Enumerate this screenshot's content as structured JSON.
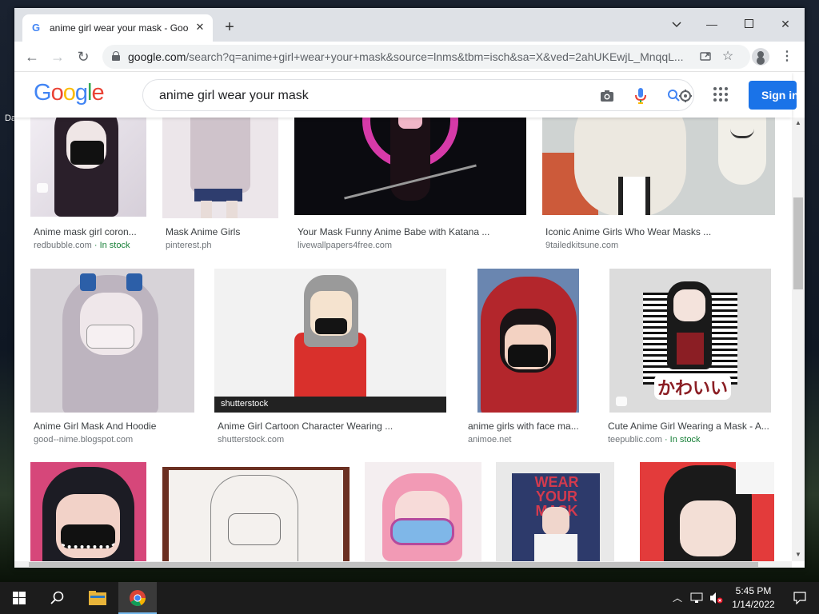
{
  "desktop": {
    "partial_labels": [
      "Da"
    ]
  },
  "browser": {
    "tab_title": "anime girl wear your mask - Goo",
    "url_host": "google.com",
    "url_rest": "/search?q=anime+girl+wear+your+mask&source=lnms&tbm=isch&sa=X&ved=2ahUKEwjL_MnqqL..."
  },
  "google": {
    "logo_letters": [
      "G",
      "o",
      "o",
      "g",
      "l",
      "e"
    ],
    "logo_colors": [
      "#4285f4",
      "#ea4335",
      "#fbbc05",
      "#4285f4",
      "#34a853",
      "#ea4335"
    ],
    "query": "anime girl wear your mask",
    "signin_label": "Sign in"
  },
  "results": [
    {
      "caption": "Anime mask girl coron...",
      "source": "redbubble.com",
      "stock": "· In stock",
      "palette": [
        "#e8e4ee",
        "#2a1f2a"
      ]
    },
    {
      "caption": "Mask Anime Girls",
      "source": "pinterest.ph",
      "stock": "",
      "palette": [
        "#e9e3e8",
        "#b9aab5"
      ]
    },
    {
      "caption": "Your Mask Funny Anime Babe with Katana ...",
      "source": "livewallpapers4free.com",
      "stock": "",
      "palette": [
        "#0b0b10",
        "#d63aa8"
      ]
    },
    {
      "caption": "Iconic Anime Girls Who Wear Masks ...",
      "source": "9tailedkitsune.com",
      "stock": "",
      "palette": [
        "#d9d6cf",
        "#cc5a3a"
      ]
    },
    {
      "caption": "Anime Girl Mask And Hoodie",
      "source": "good--nime.blogspot.com",
      "stock": "",
      "palette": [
        "#d7d3d8",
        "#8a7f8c"
      ]
    },
    {
      "caption": "Anime Girl Cartoon Character Wearing ...",
      "source": "shutterstock.com",
      "stock": "",
      "palette": [
        "#f2f2f2",
        "#d9302c"
      ]
    },
    {
      "caption": "anime girls with face ma...",
      "source": "animoe.net",
      "stock": "",
      "palette": [
        "#6a86b0",
        "#b3262c"
      ]
    },
    {
      "caption": "Cute Anime Girl Wearing a Mask - A...",
      "source": "teepublic.com",
      "stock": "· In stock",
      "palette": [
        "#dcdcdc",
        "#111111"
      ]
    },
    {
      "caption": "",
      "source": "",
      "stock": "",
      "palette": [
        "#d6477a",
        "#1c1c24"
      ]
    },
    {
      "caption": "",
      "source": "",
      "stock": "",
      "palette": [
        "#f4f1ee",
        "#6b3022"
      ]
    },
    {
      "caption": "",
      "source": "",
      "stock": "",
      "palette": [
        "#f4eef0",
        "#f29ab5"
      ]
    },
    {
      "caption": "",
      "source": "",
      "stock": "",
      "palette": [
        "#2d3a6b",
        "#d33a4e"
      ]
    },
    {
      "caption": "",
      "source": "",
      "stock": "",
      "palette": [
        "#e33b3b",
        "#1a1a1a"
      ]
    }
  ],
  "thumb_text": {
    "shutterstock": "shutterstock",
    "kawaii": "かわいい",
    "wear_your_mask": "WEAR YOUR MASK"
  },
  "taskbar": {
    "time": "5:45 PM",
    "date": "1/14/2022"
  }
}
